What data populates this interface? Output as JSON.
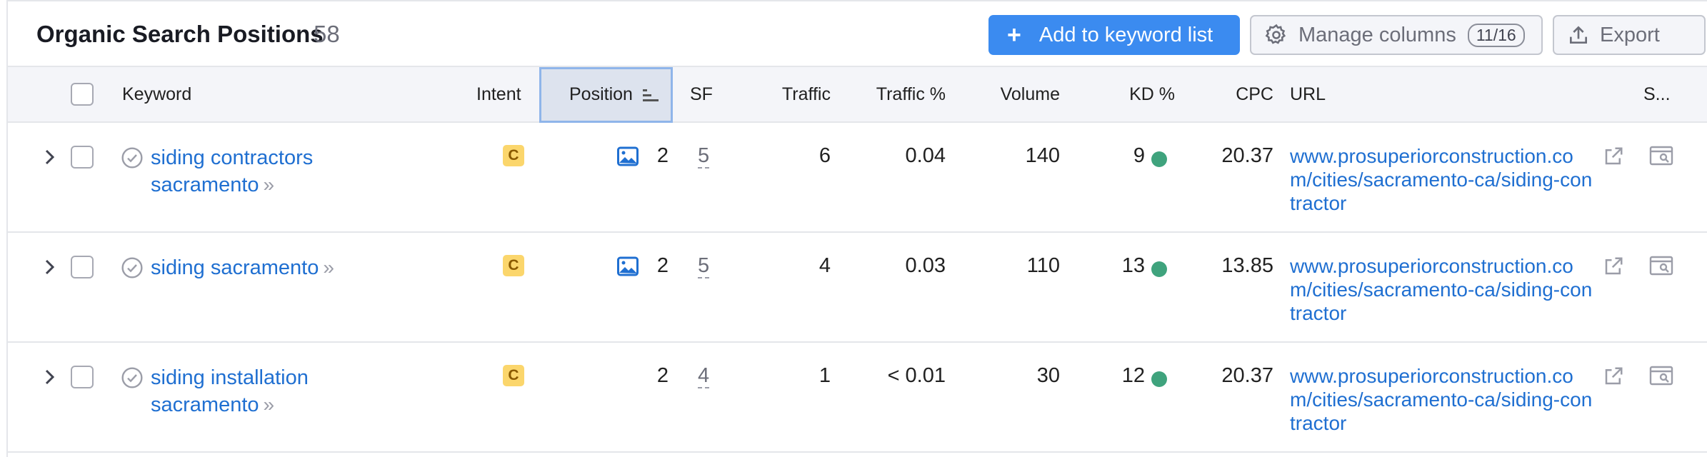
{
  "header": {
    "title": "Organic Search Positions",
    "count": "58",
    "add_button": "Add to keyword list",
    "manage_button": "Manage columns",
    "manage_badge": "11/16",
    "export_button": "Export"
  },
  "columns": {
    "keyword": "Keyword",
    "intent": "Intent",
    "position": "Position",
    "sf": "SF",
    "traffic": "Traffic",
    "traffic_pct": "Traffic %",
    "volume": "Volume",
    "kd": "KD %",
    "cpc": "CPC",
    "url": "URL",
    "serp": "S..."
  },
  "colors": {
    "accent": "#3b8bf0",
    "link": "#1f6fd1",
    "intent_badge": "#fbd66c",
    "kd_easy": "#3fa37d",
    "header_bg": "#f4f5f9"
  },
  "rows": [
    {
      "keyword": "siding contractors sacramento",
      "intent": "C",
      "position": "2",
      "has_image_feature": true,
      "sf": "5",
      "traffic": "6",
      "traffic_pct": "0.04",
      "volume": "140",
      "kd": "9",
      "cpc": "20.37",
      "url": "www.prosuperiorconstruction.com/cities/sacramento-ca/siding-contractor"
    },
    {
      "keyword": "siding sacramento",
      "intent": "C",
      "position": "2",
      "has_image_feature": true,
      "sf": "5",
      "traffic": "4",
      "traffic_pct": "0.03",
      "volume": "110",
      "kd": "13",
      "cpc": "13.85",
      "url": "www.prosuperiorconstruction.com/cities/sacramento-ca/siding-contractor"
    },
    {
      "keyword": "siding installation sacramento",
      "intent": "C",
      "position": "2",
      "has_image_feature": false,
      "sf": "4",
      "traffic": "1",
      "traffic_pct": "< 0.01",
      "volume": "30",
      "kd": "12",
      "cpc": "20.37",
      "url": "www.prosuperiorconstruction.com/cities/sacramento-ca/siding-contractor"
    }
  ]
}
